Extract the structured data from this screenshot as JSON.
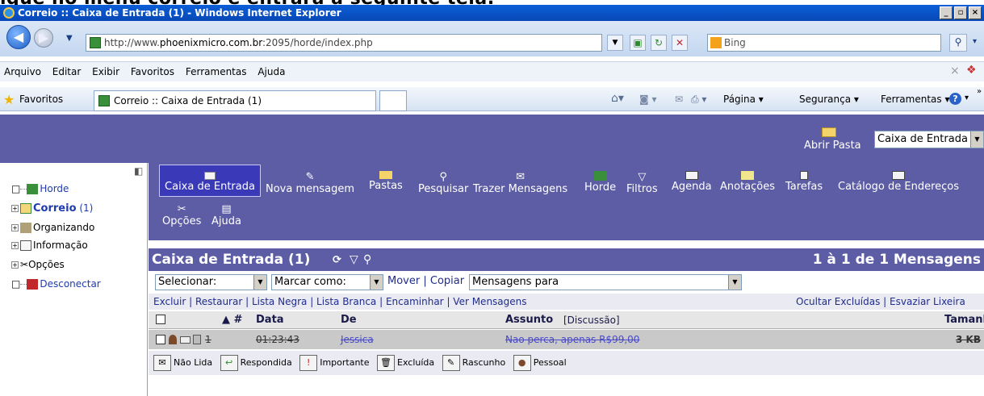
{
  "heading_text": "ique no menu correio e entrará a seguinte tela:",
  "window": {
    "title": "Correio :: Caixa de Entrada (1) - Windows Internet Explorer",
    "min": "_",
    "max": "▫",
    "close": "×"
  },
  "address": {
    "url_prefix": "http://www.",
    "url_domain": "phoenixmicro.com.br",
    "url_suffix": ":2095/horde/index.php",
    "search_placeholder": "Bing"
  },
  "menu": [
    "Arquivo",
    "Editar",
    "Exibir",
    "Favoritos",
    "Ferramentas",
    "Ajuda"
  ],
  "favbar": {
    "favorites": "Favoritos",
    "tab_title": "Correio :: Caixa de Entrada (1)",
    "page": "Página ▾",
    "security": "Segurança ▾",
    "tools": "Ferramentas ▾"
  },
  "horde_top": {
    "open_folder": "Abrir Pasta",
    "folder_select": "Caixa de Entrada"
  },
  "sidebar": {
    "horde": "Horde",
    "correio": "Correio",
    "correio_count": "(1)",
    "organizando": "Organizando",
    "informacao": "Informação",
    "opcoes": "Opções",
    "desconectar": "Desconectar"
  },
  "toolbar": {
    "items": [
      "Caixa de Entrada",
      "Nova mensagem",
      "Pastas",
      "Pesquisar",
      "Trazer Mensagens",
      "Horde",
      "Filtros",
      "Agenda",
      "Anotações",
      "Tarefas",
      "Catálogo de Endereços"
    ],
    "row2": [
      "Opções",
      "Ajuda"
    ]
  },
  "mailbox": {
    "title": "Caixa de Entrada (1)",
    "range": "1 à 1 de 1 Mensagens",
    "select": "Selecionar:",
    "mark_as": "Marcar como:",
    "move": "Mover",
    "copy": "Copiar",
    "messages_to": "Mensagens para",
    "actions": [
      "Excluir",
      "Restaurar",
      "Lista Negra",
      "Lista Branca",
      "Encaminhar",
      "Ver Mensagens"
    ],
    "right_actions": [
      "Ocultar Excluídas",
      "Esvaziar Lixeira"
    ],
    "columns": {
      "num": "▲ #",
      "date": "Data",
      "from": "De",
      "subject": "Assunto",
      "discussion": "[Discussão]",
      "size": "Tamanh"
    },
    "row": {
      "num": "1",
      "date": "01:23:43",
      "from": "Jessica",
      "subject": "Nao perca, apenas R$99,00",
      "size": "3 KB"
    }
  },
  "legend": [
    "Não Lida",
    "Respondida",
    "Importante",
    "Excluída",
    "Rascunho",
    "Pessoal"
  ],
  "colors": {
    "horde_purple": "#5d5da6",
    "link_blue": "#1f3bb0",
    "titlebar": "#0a5fd8"
  }
}
